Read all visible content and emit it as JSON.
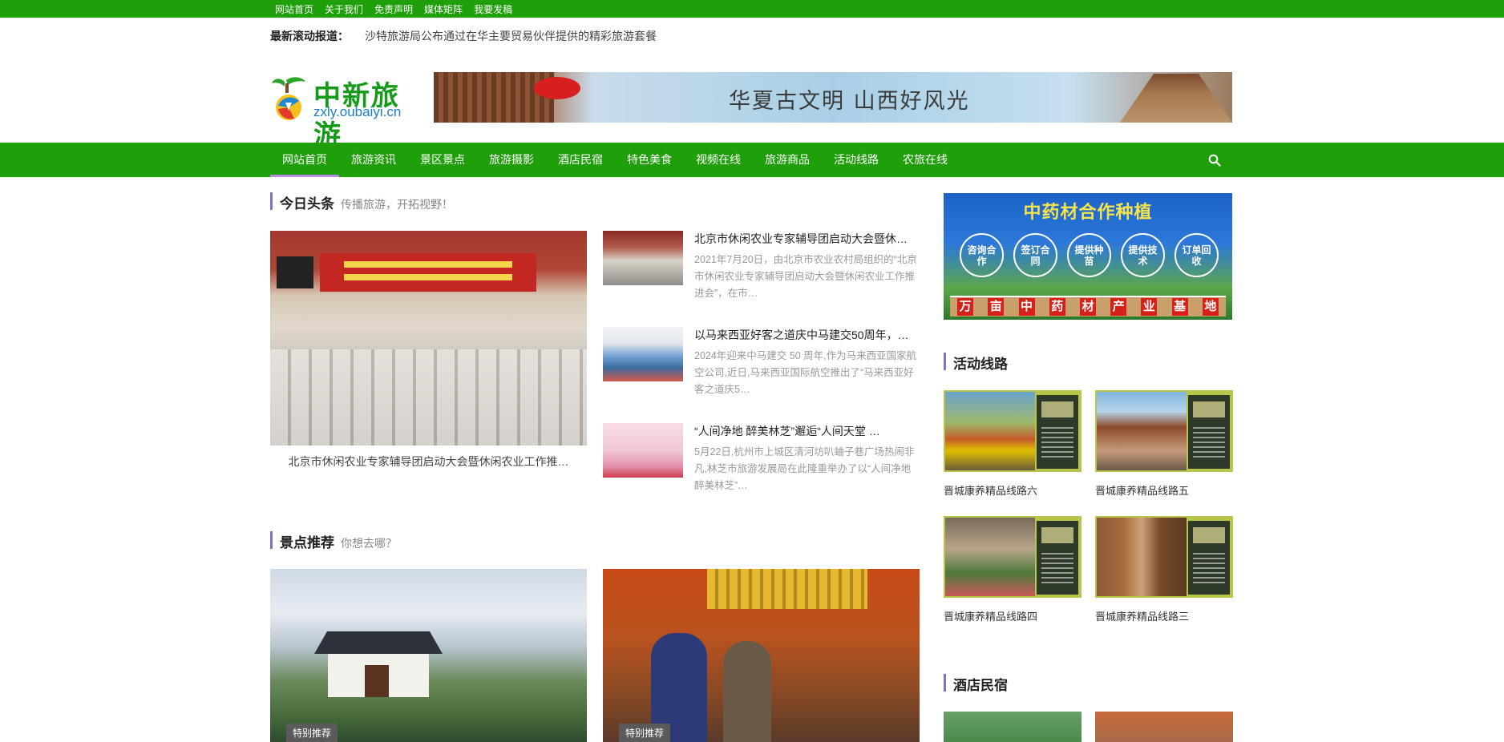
{
  "topbar": {
    "links": [
      "网站首页",
      "关于我们",
      "免责声明",
      "媒体矩阵",
      "我要发稿"
    ]
  },
  "ticker": {
    "label": "最新滚动报道：",
    "text": "沙特旅游局公布通过在华主要贸易伙伴提供的精彩旅游套餐"
  },
  "logo": {
    "title": "中新旅游",
    "url": "zxly.oubaiyi.cn"
  },
  "banner": {
    "text": "华夏古文明 山西好风光"
  },
  "nav": {
    "items": [
      "网站首页",
      "旅游资讯",
      "景区景点",
      "旅游摄影",
      "酒店民宿",
      "特色美食",
      "视频在线",
      "旅游商品",
      "活动线路",
      "农旅在线"
    ],
    "active_index": 0,
    "search_icon": "search-icon"
  },
  "headlines": {
    "title": "今日头条",
    "subtitle": "传播旅游，开拓视野！",
    "big_caption": "北京市休闲农业专家辅导团启动大会暨休闲农业工作推…",
    "items": [
      {
        "title": "北京市休闲农业专家辅导团启动大会暨休…",
        "desc": "2021年7月20日，由北京市农业农村局组织的“北京市休闲农业专家辅导团启动大会暨休闲农业工作推进会”，在市…"
      },
      {
        "title": "以马来西亚好客之道庆中马建交50周年，…",
        "desc": "2024年迎来中马建交 50 周年,作为马来西亚国家航空公司,近日,马来西亚国际航空推出了“马来西亚好客之道庆5…"
      },
      {
        "title": "“人间净地 醉美林芝”邂逅“人间天堂 …",
        "desc": "5月22日,杭州市上城区清河坊叭蛐子巷广场热闹非凡,林芝市旅游发展局在此隆重举办了以“人间净地 醉美林芝”…"
      }
    ]
  },
  "spots": {
    "title": "景点推荐",
    "subtitle": "你想去哪？",
    "tag": "特别推荐"
  },
  "sidebar": {
    "ad": {
      "title": "中药材合作种植",
      "circles": [
        "咨询合作",
        "签订合同",
        "提供种苗",
        "提供技术",
        "订单回收"
      ],
      "bottom": [
        "万",
        "亩",
        "中",
        "药",
        "材",
        "产",
        "业",
        "基",
        "地"
      ]
    },
    "routes_title": "活动线路",
    "routes": [
      "晋城康养精品线路六",
      "晋城康养精品线路五",
      "晋城康养精品线路四",
      "晋城康养精品线路三"
    ],
    "hotels_title": "酒店民宿"
  },
  "colors": {
    "brand_green": "#1f9f0a",
    "accent_purple": "#7b73c9"
  }
}
